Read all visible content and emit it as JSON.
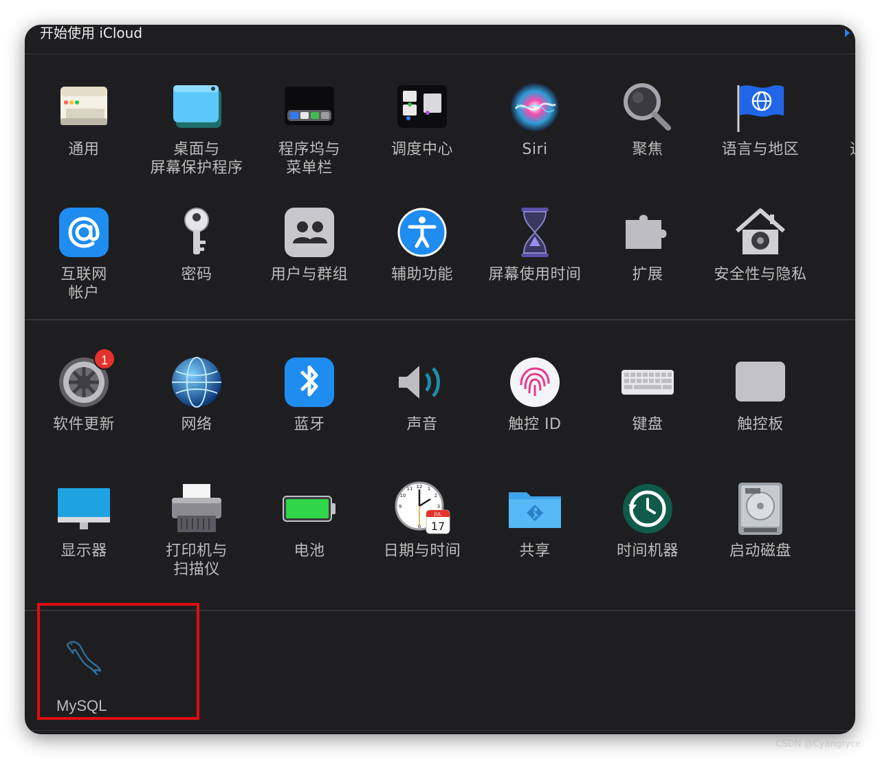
{
  "banner": {
    "text": "开始使用 iCloud"
  },
  "section1": [
    {
      "id": "general",
      "label": "通用",
      "icon": "general-icon"
    },
    {
      "id": "desktop",
      "label": "桌面与\n屏幕保护程序",
      "icon": "desktop-icon"
    },
    {
      "id": "dock",
      "label": "程序坞与\n菜单栏",
      "icon": "dock-icon"
    },
    {
      "id": "mission-control",
      "label": "调度中心",
      "icon": "mission-control-icon"
    },
    {
      "id": "siri",
      "label": "Siri",
      "icon": "siri-icon"
    },
    {
      "id": "spotlight",
      "label": "聚焦",
      "icon": "spotlight-icon"
    },
    {
      "id": "language",
      "label": "语言与地区",
      "icon": "globe-flag-icon"
    },
    {
      "id": "notifications",
      "label": "通知与",
      "icon": "notifications-icon"
    },
    {
      "id": "internet-accounts",
      "label": "互联网\n帐户",
      "icon": "at-icon"
    },
    {
      "id": "passwords",
      "label": "密码",
      "icon": "key-icon"
    },
    {
      "id": "users",
      "label": "用户与群组",
      "icon": "users-icon"
    },
    {
      "id": "accessibility",
      "label": "辅助功能",
      "icon": "accessibility-icon"
    },
    {
      "id": "screen-time",
      "label": "屏幕使用时间",
      "icon": "hourglass-icon"
    },
    {
      "id": "extensions",
      "label": "扩展",
      "icon": "puzzle-icon"
    },
    {
      "id": "security",
      "label": "安全性与隐私",
      "icon": "security-house-icon"
    }
  ],
  "section2": [
    {
      "id": "software-update",
      "label": "软件更新",
      "icon": "gear-icon",
      "badge": "1"
    },
    {
      "id": "network",
      "label": "网络",
      "icon": "network-globe-icon"
    },
    {
      "id": "bluetooth",
      "label": "蓝牙",
      "icon": "bluetooth-icon"
    },
    {
      "id": "sound",
      "label": "声音",
      "icon": "speaker-icon"
    },
    {
      "id": "touch-id",
      "label": "触控 ID",
      "icon": "fingerprint-icon"
    },
    {
      "id": "keyboard",
      "label": "键盘",
      "icon": "keyboard-icon"
    },
    {
      "id": "trackpad",
      "label": "触控板",
      "icon": "trackpad-icon"
    },
    {
      "id": "displays",
      "label": "显示器",
      "icon": "display-icon"
    },
    {
      "id": "printers",
      "label": "打印机与\n扫描仪",
      "icon": "printer-icon"
    },
    {
      "id": "battery",
      "label": "电池",
      "icon": "battery-icon"
    },
    {
      "id": "date-time",
      "label": "日期与时间",
      "icon": "clock-calendar-icon",
      "calendar_month": "JUL",
      "calendar_day": "17"
    },
    {
      "id": "sharing",
      "label": "共享",
      "icon": "sharing-folder-icon"
    },
    {
      "id": "time-machine",
      "label": "时间机器",
      "icon": "time-machine-icon"
    },
    {
      "id": "startup-disk",
      "label": "启动磁盘",
      "icon": "disk-icon"
    }
  ],
  "section3": [
    {
      "id": "mysql",
      "label": "MySQL",
      "icon": "mysql-dolphin-icon"
    }
  ],
  "colors": {
    "background": "#1e1e21",
    "highlight": "#e10d0d",
    "label": "#bcbcbc"
  },
  "watermark": "CSDN @Cyangryce"
}
